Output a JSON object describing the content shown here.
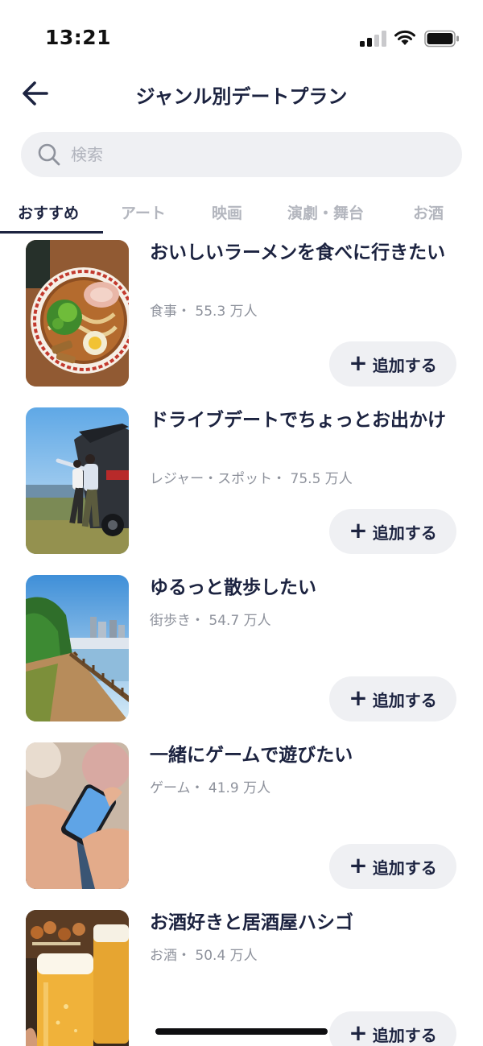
{
  "status_bar": {
    "time": "13:21"
  },
  "header": {
    "title": "ジャンル別デートプラン"
  },
  "search": {
    "placeholder": "検索"
  },
  "tabs": [
    {
      "label": "おすすめ",
      "active": true
    },
    {
      "label": "アート"
    },
    {
      "label": "映画"
    },
    {
      "label": "演劇・舞台"
    },
    {
      "label": "お酒"
    }
  ],
  "plans": [
    {
      "title": "おいしいラーメンを食べに行きたい",
      "meta": "食事・ 55.3 万人",
      "add_label": "追加する",
      "image_icon": "ramen-photo"
    },
    {
      "title": "ドライブデートでちょっとお出かけ",
      "meta": "レジャー・スポット・ 75.5 万人",
      "add_label": "追加する",
      "image_icon": "drive-photo"
    },
    {
      "title": "ゆるっと散歩したい",
      "meta": "街歩き・ 54.7 万人",
      "add_label": "追加する",
      "image_icon": "walk-photo"
    },
    {
      "title": "一緒にゲームで遊びたい",
      "meta": "ゲーム・ 41.9 万人",
      "add_label": "追加する",
      "image_icon": "game-photo"
    },
    {
      "title": "お酒好きと居酒屋ハシゴ",
      "meta": "お酒・ 50.4 万人",
      "add_label": "追加する",
      "image_icon": "beer-photo"
    }
  ],
  "colors": {
    "text_primary": "#1c2340",
    "text_secondary": "#8e929c",
    "button_bg": "#eff0f3",
    "tab_inactive": "#b3b6be"
  }
}
